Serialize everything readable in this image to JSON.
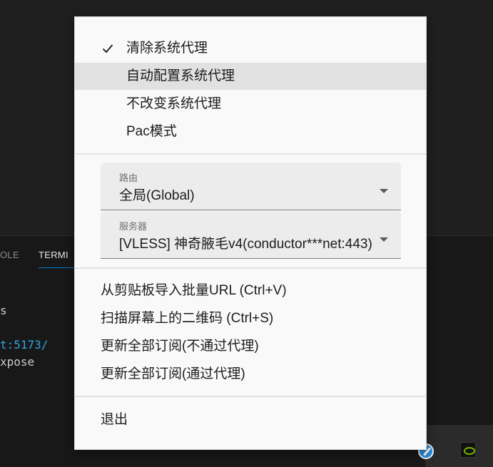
{
  "background": {
    "panel_tabs": {
      "console": "OLE",
      "terminal": "TERMI"
    },
    "terminal_lines": {
      "line1": "s",
      "line2_url": "t:5173/",
      "line3": "xpose"
    }
  },
  "proxy_modes": [
    {
      "label": "清除系统代理",
      "checked": true
    },
    {
      "label": "自动配置系统代理",
      "checked": false,
      "highlighted": true
    },
    {
      "label": "不改变系统代理",
      "checked": false
    },
    {
      "label": "Pac模式",
      "checked": false
    }
  ],
  "routing": {
    "caption": "路由",
    "value": "全局(Global)"
  },
  "server": {
    "caption": "服务器",
    "value": "[VLESS] 神奇腋毛v4(conductor***net:443)"
  },
  "actions": [
    {
      "label": "从剪贴板导入批量URL (Ctrl+V)"
    },
    {
      "label": "扫描屏幕上的二维码 (Ctrl+S)"
    },
    {
      "label": "更新全部订阅(不通过代理)"
    },
    {
      "label": "更新全部订阅(通过代理)"
    }
  ],
  "exit": {
    "label": "退出"
  },
  "colors": {
    "menu_bg": "#f9f9f9",
    "highlight": "#e1e1e1",
    "terminal_url": "#2fa8e0",
    "tab_accent": "#0078d4"
  },
  "icons": {
    "check": "check-icon",
    "dropdown": "chevron-down-icon",
    "tray_v2ray": "v2rayn-tray-icon",
    "tray_nvidia": "nvidia-tray-icon"
  }
}
